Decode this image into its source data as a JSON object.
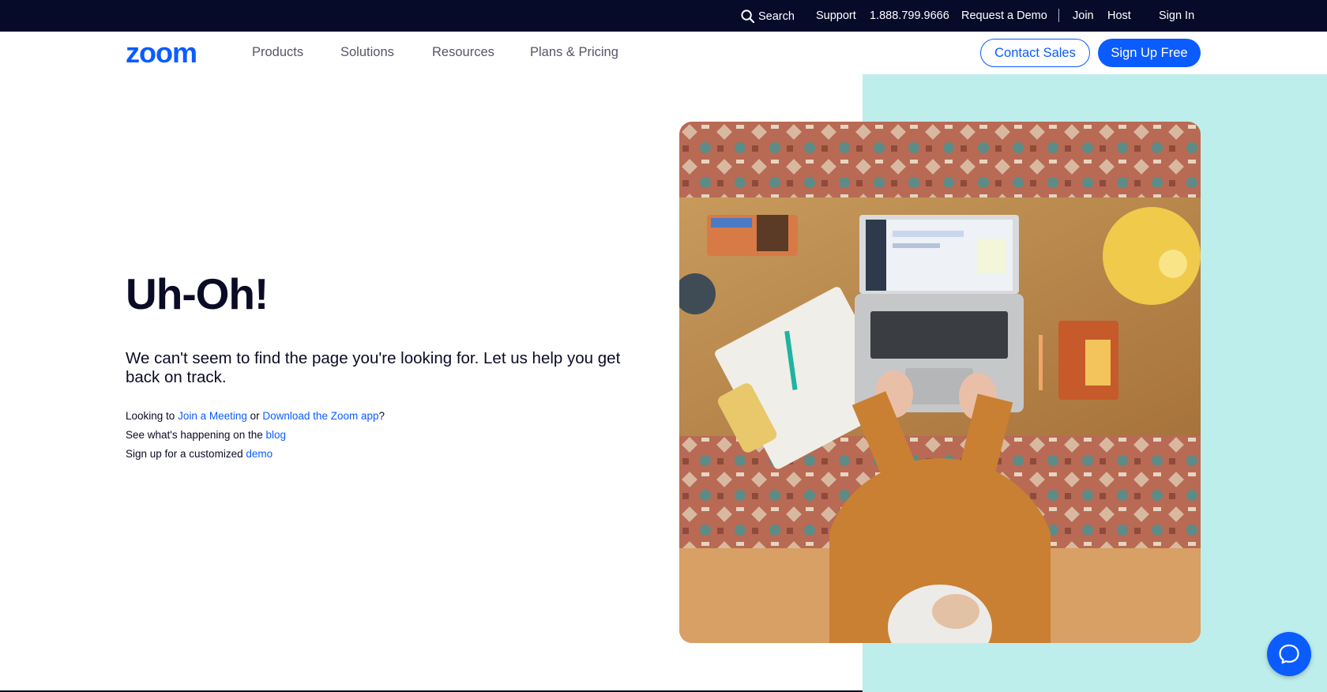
{
  "topbar": {
    "search_label": "Search",
    "support": "Support",
    "phone": "1.888.799.9666",
    "request_demo": "Request a Demo",
    "join": "Join",
    "host": "Host",
    "sign_in": "Sign In"
  },
  "nav": {
    "logo_text": "zoom",
    "items": [
      "Products",
      "Solutions",
      "Resources",
      "Plans & Pricing"
    ],
    "contact_sales": "Contact Sales",
    "sign_up_free": "Sign Up Free"
  },
  "hero": {
    "heading": "Uh-Oh!",
    "lead": "We can't seem to find the page you're looking for. Let us help you get back on track.",
    "line1": {
      "prefix": "Looking to ",
      "link1": "Join a Meeting",
      "middle": " or ",
      "link2": "Download the Zoom app",
      "suffix": "?"
    },
    "line2": {
      "prefix": "See what's happening on the ",
      "link": "blog"
    },
    "line3": {
      "prefix": "Sign up for a customized ",
      "link": "demo"
    }
  },
  "colors": {
    "brand_blue": "#0b5cff",
    "topbar_bg": "#070b2a",
    "teal_panel": "#bdeeeb",
    "text_dark": "#0a0b25"
  },
  "icons": {
    "search": "search-icon",
    "chat": "chat-bubble-icon",
    "logo": "zoom-logo"
  }
}
